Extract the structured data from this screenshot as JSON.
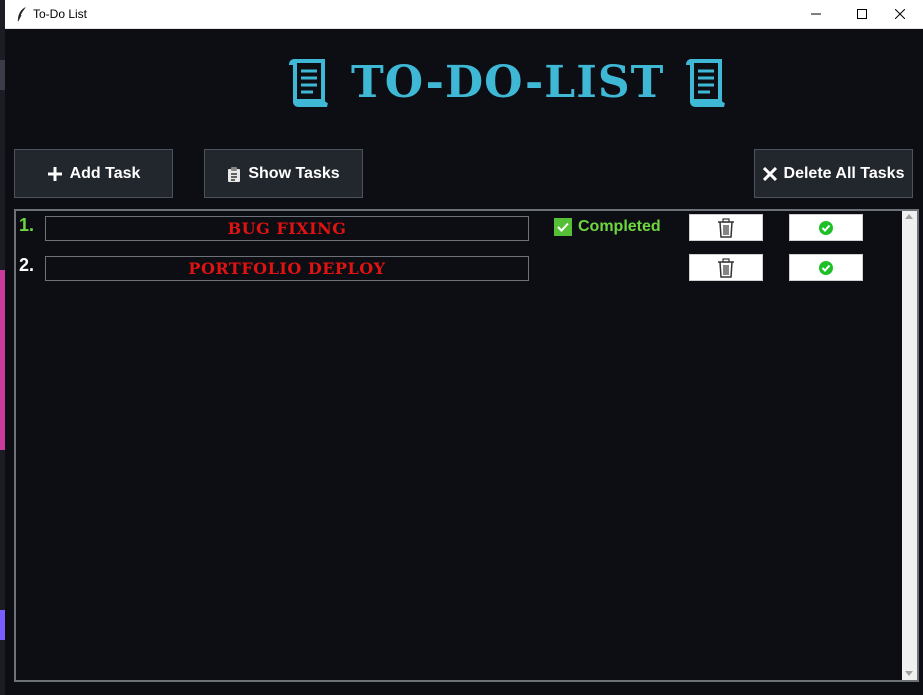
{
  "window": {
    "title": "To-Do List",
    "app_icon": "feather-icon"
  },
  "header": {
    "title": "TO-DO-LIST",
    "icon": "scroll-icon",
    "color": "#3fb8d6"
  },
  "toolbar": {
    "add_label": "Add Task",
    "show_label": "Show Tasks",
    "delete_all_label": "Delete All Tasks"
  },
  "tasks": [
    {
      "number": "1.",
      "name": "BUG FIXING",
      "status": "Completed",
      "completed": true,
      "number_color": "#6ed63f"
    },
    {
      "number": "2.",
      "name": "PORTFOLIO DEPLOY",
      "status": "",
      "completed": false,
      "number_color": "#ffffff"
    }
  ],
  "colors": {
    "background": "#0c0e13",
    "task_text": "#e01212",
    "completed": "#6ed63f",
    "button_bg": "#22262d"
  }
}
